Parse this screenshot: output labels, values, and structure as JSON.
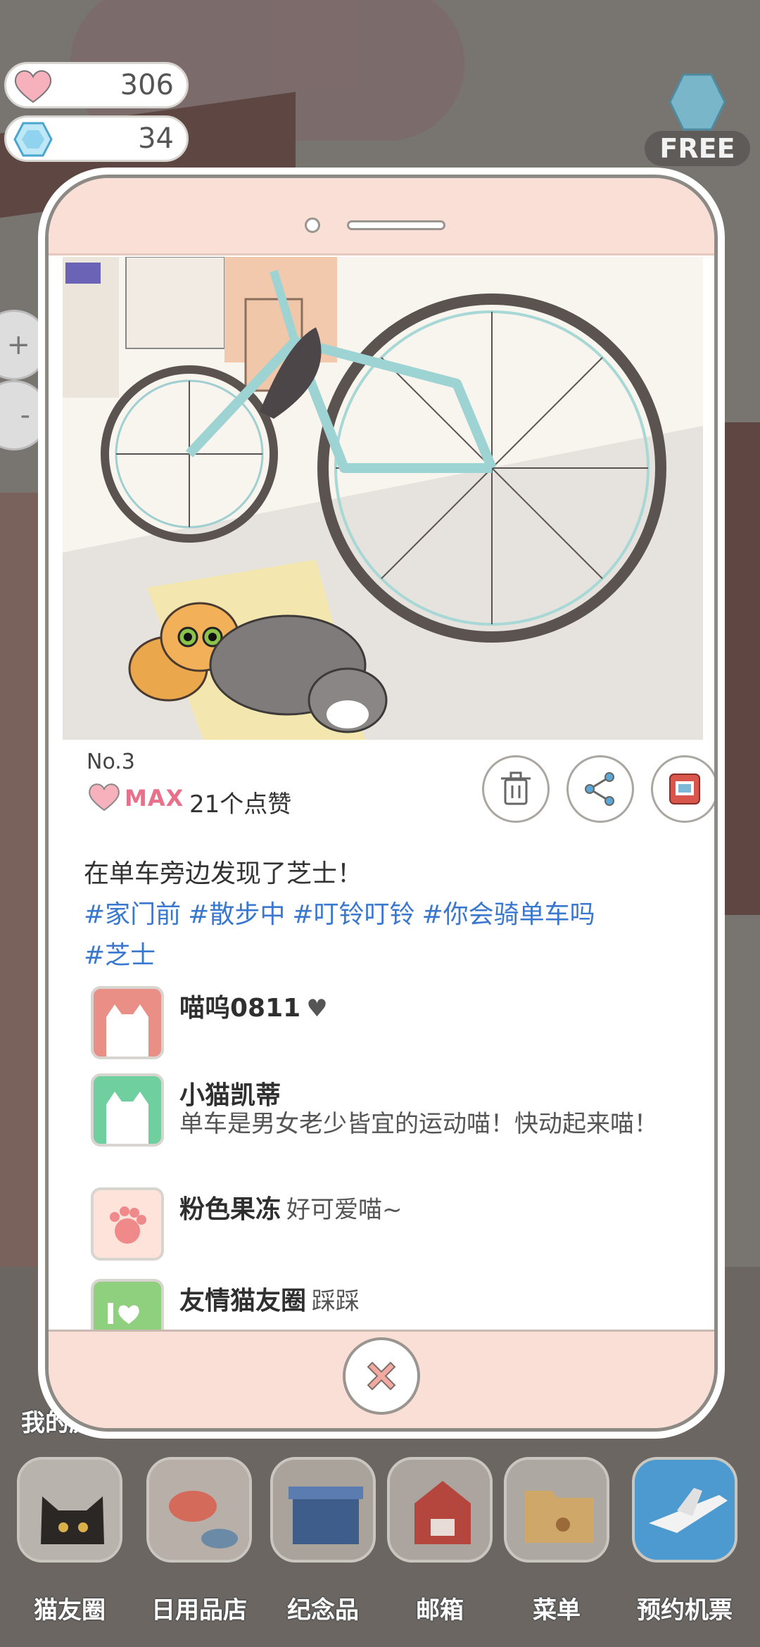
{
  "hud": {
    "hearts": "306",
    "gems": "34",
    "free_label": "FREE"
  },
  "side_controls": {
    "zoom_in": "+",
    "zoom_out": "-"
  },
  "post": {
    "number": "No.3",
    "max_label": "MAX",
    "likes": "21个点赞",
    "caption": "在单车旁边发现了芝士！",
    "tags": [
      "#家门前",
      "#散步中",
      "#叮铃叮铃",
      "#你会骑单车吗",
      "#芝士"
    ]
  },
  "comments": [
    {
      "name": "喵呜0811",
      "text": "♥",
      "avatar_color": "#e98f86"
    },
    {
      "name": "小猫凯蒂",
      "text": "单车是男女老少皆宜的运动喵！快动起来喵！",
      "avatar_color": "#6fcf9e"
    },
    {
      "name": "粉色果冻",
      "text": "好可爱喵~",
      "avatar_color": "#fde3da"
    },
    {
      "name": "友情猫友圈",
      "text": "踩踩",
      "avatar_color": "#8fd07f"
    }
  ],
  "history_label": "我的历",
  "dock": [
    {
      "label": "猫友圈"
    },
    {
      "label": "日用品店"
    },
    {
      "label": "纪念品"
    },
    {
      "label": "邮箱"
    },
    {
      "label": "菜单"
    },
    {
      "label": "预约机票"
    }
  ],
  "colors": {
    "accent_pink": "#e8708a",
    "tag_blue": "#3a78d0",
    "phone_frame_pink": "#f9dfd5"
  }
}
